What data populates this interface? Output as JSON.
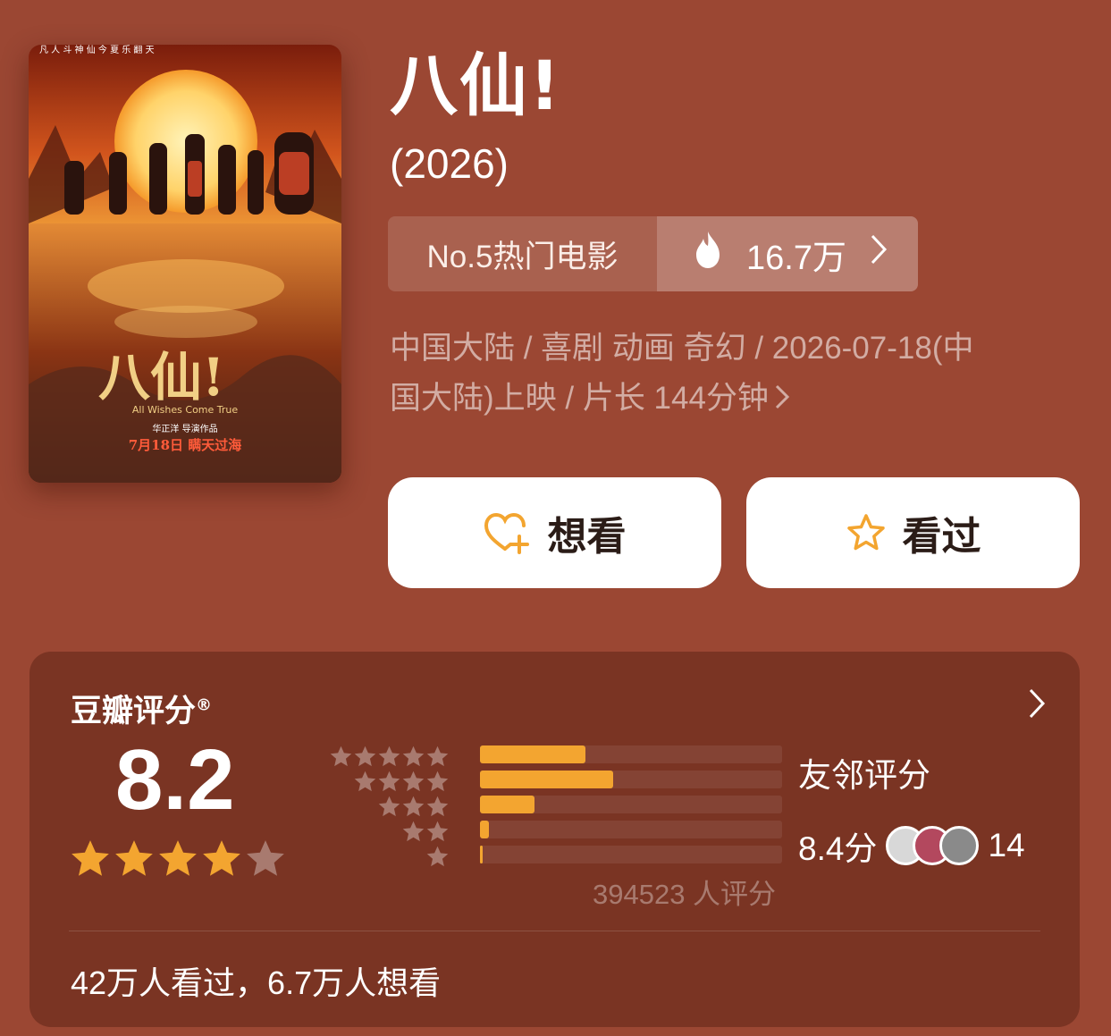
{
  "colors": {
    "background": "#9b4733",
    "card": "#7a3423",
    "accent_orange": "#f3a530",
    "button_bg": "#ffffff"
  },
  "poster": {
    "top_tagline": "凡 人 斗 神 仙      今 夏 乐 翻 天",
    "logo_text": "八仙!",
    "english_title": "All Wishes Come True",
    "director_credit": "华正洋 导演作品",
    "release_line": "7月18日 瞒天过海"
  },
  "movie": {
    "title": "八仙!",
    "year": "(2026)"
  },
  "rank": {
    "label": "No.5热门电影",
    "heat_icon": "flame-icon",
    "heat_value": "16.7万"
  },
  "meta": {
    "line1": "中国大陆 / 喜剧 动画 奇幻 / 2026-07-18(中",
    "line2": "国大陆)上映 / 片长 144分钟"
  },
  "actions": {
    "want_label": "想看",
    "want_icon": "heart-plus-icon",
    "seen_label": "看过",
    "seen_icon": "star-outline-icon"
  },
  "rating": {
    "title": "豆瓣评分",
    "registered": "®",
    "score": "8.2",
    "stars_filled": 4,
    "stars_total": 5,
    "distribution": [
      {
        "stars": 5,
        "fraction": 0.35
      },
      {
        "stars": 4,
        "fraction": 0.44
      },
      {
        "stars": 3,
        "fraction": 0.18
      },
      {
        "stars": 2,
        "fraction": 0.03
      },
      {
        "stars": 1,
        "fraction": 0.01
      }
    ],
    "raters_text": "394523 人评分",
    "friend_title": "友邻评分",
    "friend_score": "8.4分",
    "friend_count": "14",
    "footer": "42万人看过，6.7万人想看"
  }
}
